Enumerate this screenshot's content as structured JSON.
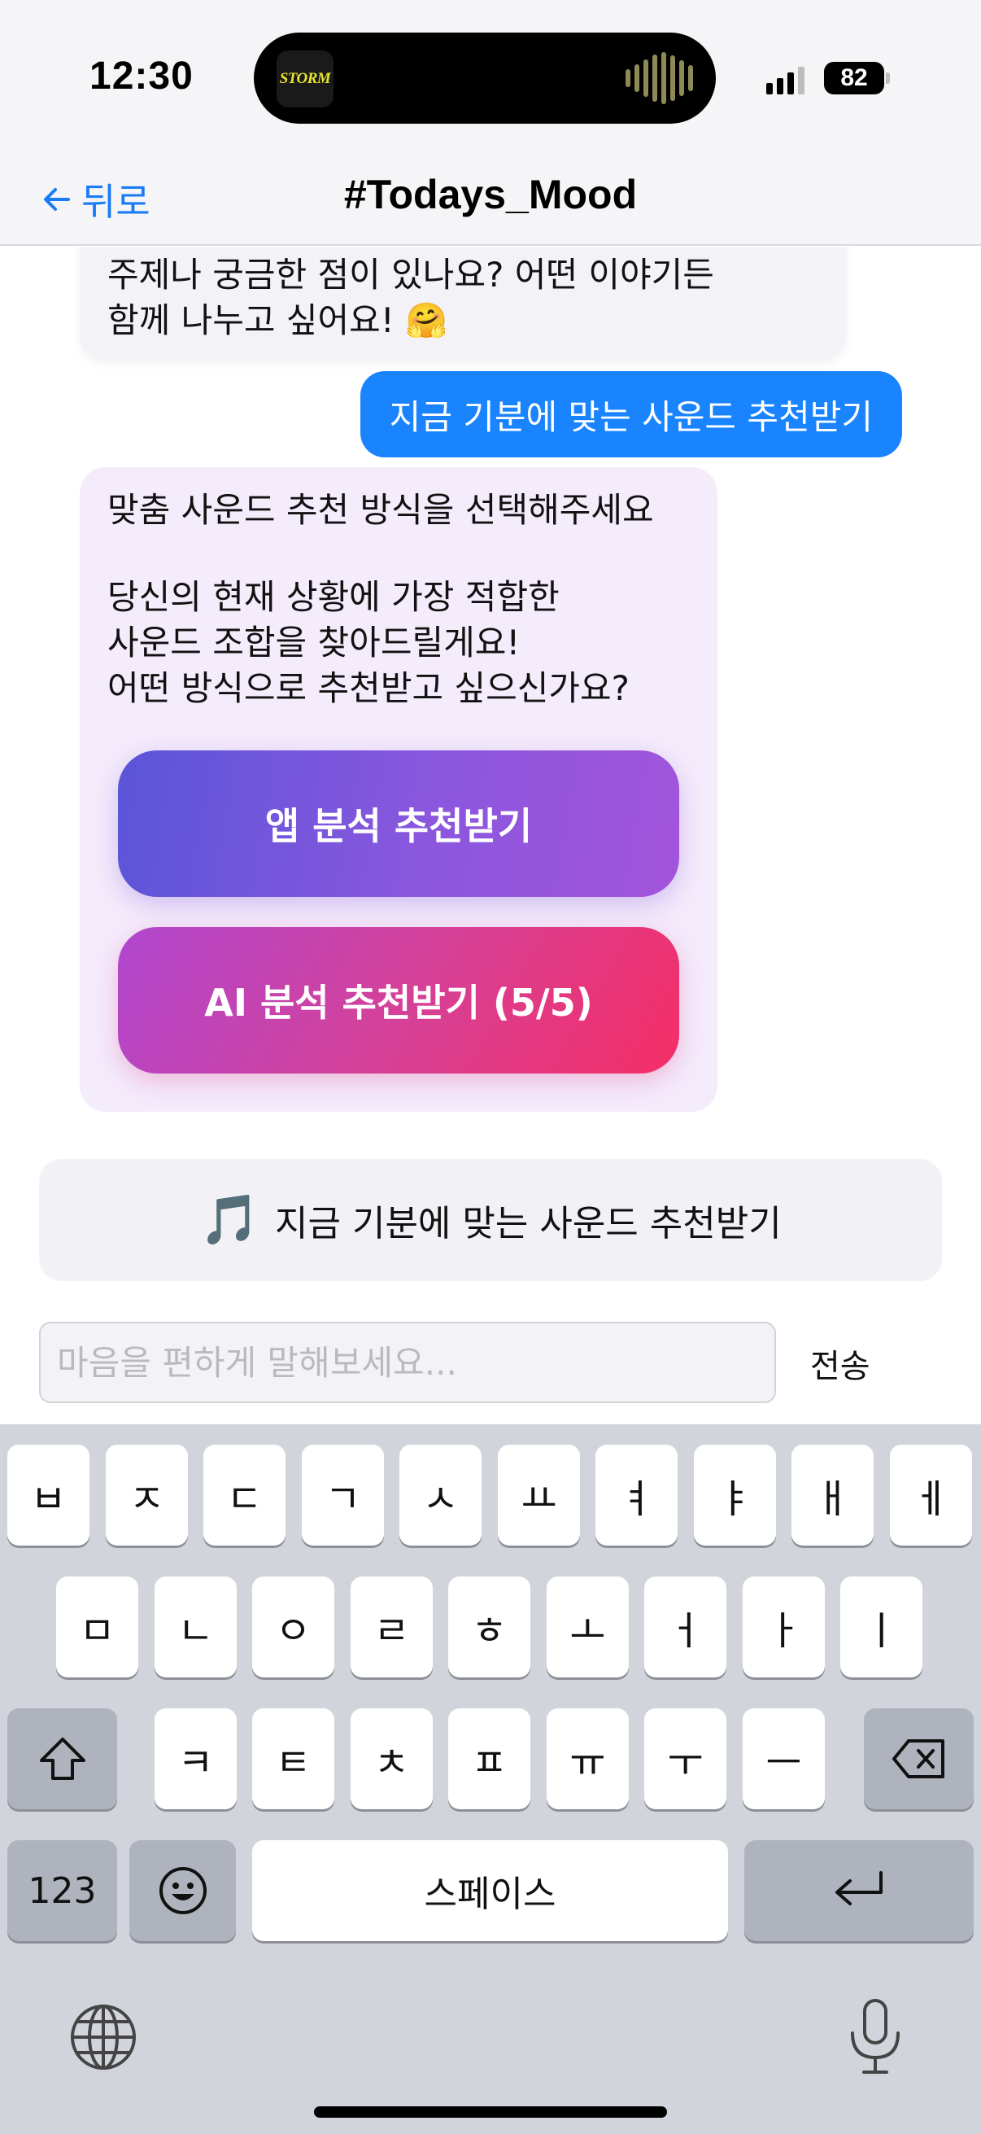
{
  "status_bar": {
    "time": "12:30",
    "island_app_label": "STORM",
    "battery_level": "82",
    "signal_bars": 3,
    "icons": [
      "signal-icon",
      "battery-icon"
    ]
  },
  "nav": {
    "back_label": "뒤로",
    "title": "#Todays_Mood",
    "icons": [
      "back-arrow-icon"
    ]
  },
  "chat": {
    "previous_bot_message": "주제나 궁금한 점이 있나요? 어떤 이야기든\n함께 나누고 싶어요! 🤗",
    "user_message": "지금 기분에 맞는 사운드 추천받기",
    "bot_message": {
      "title": "맞춤 사운드 추천 방식을 선택해주세요",
      "body": "당신의 현재 상황에 가장 적합한\n사운드 조합을 찾아드릴게요!\n어떤 방식으로 추천받고 싶으신가요?",
      "app_button_label": "앱 분석 추천받기",
      "ai_button_label": "AI 분석 추천받기 (5/5)"
    },
    "quick_action": {
      "icon": "🎵",
      "label": "지금 기분에 맞는 사운드 추천받기"
    }
  },
  "input": {
    "placeholder": "마음을 편하게 말해보세요...",
    "value": "",
    "send_label": "전송"
  },
  "keyboard": {
    "row1": [
      "ㅂ",
      "ㅈ",
      "ㄷ",
      "ㄱ",
      "ㅅ",
      "ㅛ",
      "ㅕ",
      "ㅑ",
      "ㅐ",
      "ㅔ"
    ],
    "row2": [
      "ㅁ",
      "ㄴ",
      "ㅇ",
      "ㄹ",
      "ㅎ",
      "ㅗ",
      "ㅓ",
      "ㅏ",
      "ㅣ"
    ],
    "row3": [
      "ㅋ",
      "ㅌ",
      "ㅊ",
      "ㅍ",
      "ㅠ",
      "ㅜ",
      "ㅡ"
    ],
    "numbers_label": "123",
    "space_label": "스페이스",
    "icons": [
      "shift-icon",
      "backspace-icon",
      "emoji-icon",
      "return-icon",
      "globe-icon",
      "microphone-icon"
    ]
  },
  "colors": {
    "accent_blue": "#1a84ff",
    "bot_bubble": "#f4ebfb",
    "app_button_gradient": [
      "#5a55d8",
      "#a353dc"
    ],
    "ai_button_gradient": [
      "#b046cf",
      "#f52e66"
    ],
    "keyboard_bg": "#d1d4db"
  }
}
